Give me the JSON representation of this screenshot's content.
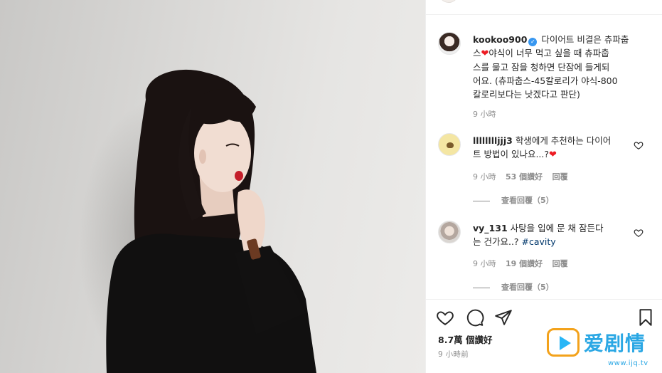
{
  "post": {
    "caption_user": "kookoo900",
    "caption_text_1": "다이어트 비결은 츄파춥",
    "caption_text_2": "스",
    "caption_text_3": "야식이 너무 먹고 싶을 때 츄파춥",
    "caption_text_4": "스를 물고 잠을 청하면 단잠에 들게되",
    "caption_text_5": "어요. (츄파춥스-45칼로리가 야식-800",
    "caption_text_6": "칼로리보다는 낫겠다고 판단)",
    "caption_time": "9 小時",
    "likes": "8.7萬 個讚好",
    "posted_ago": "9 小時前"
  },
  "comments": [
    {
      "user": "lllllllljjj3",
      "text_1": "학생에게 추천하는 다이어",
      "text_2": "트 방법이 있나요...?",
      "time": "9 小時",
      "likes": "53 個讚好",
      "reply": "回覆",
      "view_replies": "查看回覆（5）"
    },
    {
      "user": "vy_131",
      "text_1": "사탕을 입에 문 채 잠든다",
      "text_2": "는 건가요..? ",
      "hashtag": "#cavity",
      "time": "9 小時",
      "likes": "19 個讚好",
      "reply": "回覆",
      "view_replies": "查看回覆（5）"
    }
  ],
  "icons": {
    "verified": "verified-badge-icon",
    "heart": "heart-icon",
    "comment": "comment-icon",
    "share": "paper-plane-icon",
    "save": "bookmark-icon"
  },
  "colors": {
    "accent_blue": "#3897f0",
    "heart_red": "#ed1c24",
    "hashtag": "#00376b",
    "muted_text": "#8e8e8e",
    "watermark_blue": "#2aa7e4",
    "watermark_orange": "#f3a21b"
  },
  "watermark": {
    "title": "爱剧情",
    "url": "www.ijq.tv"
  }
}
